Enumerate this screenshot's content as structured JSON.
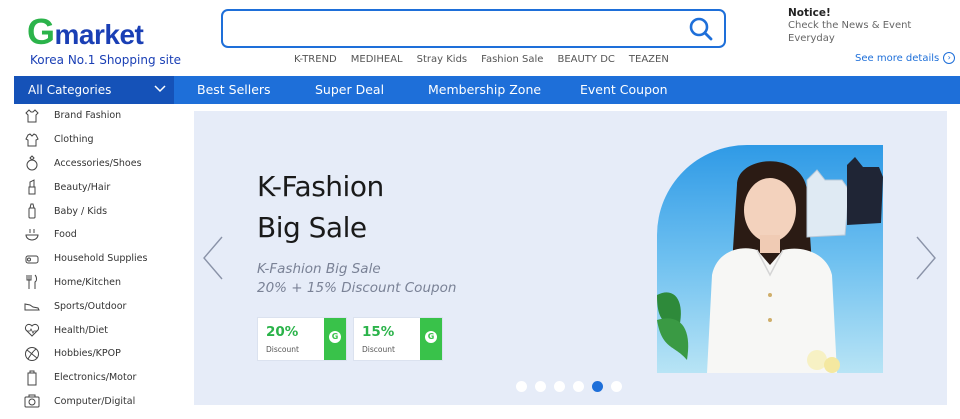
{
  "header": {
    "logo_g": "G",
    "logo_rest": "market",
    "tagline": "Korea No.1 Shopping site",
    "search": {
      "value": "",
      "placeholder": ""
    },
    "keywords": [
      "K-TREND",
      "MEDIHEAL",
      "Stray Kids",
      "Fashion Sale",
      "BEAUTY DC",
      "TEAZEN"
    ],
    "notice": {
      "title": "Notice!",
      "text": "Check the News & Event Everyday",
      "see_more": "See more details"
    }
  },
  "nav": {
    "all_categories": "All Categories",
    "items": [
      "Best Sellers",
      "Super Deal",
      "Membership Zone",
      "Event Coupon"
    ]
  },
  "sidebar": {
    "categories": [
      {
        "label": "Brand Fashion",
        "icon": "shirt-icon"
      },
      {
        "label": "Clothing",
        "icon": "top-icon"
      },
      {
        "label": "Accessories/Shoes",
        "icon": "ring-icon"
      },
      {
        "label": "Beauty/Hair",
        "icon": "lipstick-icon"
      },
      {
        "label": "Baby / Kids",
        "icon": "bottle-icon"
      },
      {
        "label": "Food",
        "icon": "bowl-icon"
      },
      {
        "label": "Household Supplies",
        "icon": "roll-icon"
      },
      {
        "label": "Home/Kitchen",
        "icon": "utensils-icon"
      },
      {
        "label": "Sports/Outdoor",
        "icon": "shoe-icon"
      },
      {
        "label": "Health/Diet",
        "icon": "heart-icon"
      },
      {
        "label": "Hobbies/KPOP",
        "icon": "ball-icon"
      },
      {
        "label": "Electronics/Motor",
        "icon": "battery-icon"
      },
      {
        "label": "Computer/Digital",
        "icon": "camera-icon"
      }
    ]
  },
  "banner": {
    "title_line1": "K-Fashion",
    "title_line2": "Big Sale",
    "subtitle_line1": "K-Fashion Big Sale",
    "subtitle_line2": "20% + 15% Discount Coupon",
    "coupons": [
      {
        "percent": "20%",
        "label": "Discount",
        "badge": "G"
      },
      {
        "percent": "15%",
        "label": "Discount",
        "badge": "G"
      }
    ],
    "slide_count": 6,
    "active_slide": 5
  },
  "colors": {
    "brand_blue": "#1a3fb5",
    "brand_green": "#2bb34a",
    "nav_blue": "#1e6fd9",
    "banner_bg": "#e6ecf8"
  }
}
